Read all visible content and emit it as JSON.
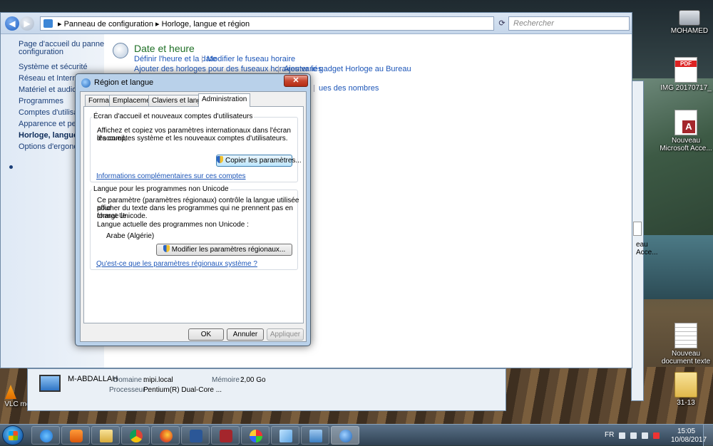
{
  "explorer": {
    "breadcrumb": {
      "part1": "Panneau de configuration",
      "sep": "▸",
      "part2": "Horloge, langue et région"
    },
    "search_placeholder": "Rechercher",
    "sidebar": [
      {
        "label": "Page d'accueil du panneau de"
      },
      {
        "label": "configuration"
      },
      {
        "label": "Système et sécurité"
      },
      {
        "label": "Réseau et Internet"
      },
      {
        "label": "Matériel et audio"
      },
      {
        "label": "Programmes"
      },
      {
        "label": "Comptes d'utilisateurs"
      },
      {
        "label": "Apparence et personn"
      },
      {
        "label": "Horloge, langue et r"
      },
      {
        "label": "Options d'ergonomie"
      }
    ],
    "category": {
      "title": "Date et heure",
      "links": [
        "Définir l'heure et la date",
        "Modifier le fuseau horaire",
        "Ajouter des horloges pour des fuseaux horaires variés",
        "Ajouter le gadget Horloge au Bureau"
      ],
      "partial_link": "ues des nombres"
    }
  },
  "sysinfo": {
    "name": "M-ABDALLAH",
    "domain_label": "Domaine :",
    "domain_value": "mipi.local",
    "memory_label": "Mémoire :",
    "memory_value": "2,00 Go",
    "cpu_label": "Processeur :",
    "cpu_value": "Pentium(R) Dual-Core ..."
  },
  "desktop_icons": [
    {
      "label": "MOHAMED",
      "icon": "computer-icon"
    },
    {
      "label": "IMG 20170717_",
      "icon": "pdf-icon"
    },
    {
      "label": "Nouveau Microsoft Acce...",
      "icon": "access-icon"
    },
    {
      "label": "Nouveau document texte",
      "icon": "text-document-icon"
    },
    {
      "label": "31-13",
      "icon": "folder-icon"
    },
    {
      "label": "VLC med",
      "icon": "vlc-icon"
    }
  ],
  "partial_desktop": {
    "line1": "eau",
    "line2": "Acce..."
  },
  "dialog": {
    "title": "Région et langue",
    "close": "✕",
    "tabs": [
      "Formats",
      "Emplacement",
      "Claviers et langues",
      "Administration"
    ],
    "welcome": {
      "title": "Écran d'accueil et nouveaux comptes d'utilisateurs",
      "line1": "Affichez et copiez vos paramètres internationaux dans l'écran d'accueil,",
      "line2": "les comptes système et les nouveaux comptes d'utilisateurs.",
      "copy_button": "Copier les paramètres...",
      "more_link": "Informations complémentaires sur ces comptes"
    },
    "unicode": {
      "title": "Langue pour les programmes non Unicode",
      "line1": "Ce paramètre (paramètres régionaux) contrôle la langue utilisée pour",
      "line2": "afficher du texte dans les programmes qui ne prennent pas en charge le",
      "line3": "format Unicode.",
      "current_label": "Langue actuelle des programmes non Unicode :",
      "current_value": "Arabe (Algérie)",
      "change_button": "Modifier les paramètres régionaux...",
      "what_link": "Qu'est-ce que les paramètres régionaux système ?"
    },
    "ok": "OK",
    "cancel": "Annuler",
    "apply": "Appliquer"
  },
  "taskbar": {
    "lang": "FR",
    "time": "15:05",
    "date": "10/08/2017",
    "apps": [
      "internet-explorer",
      "media-player",
      "file-explorer",
      "chrome",
      "firefox",
      "word",
      "access",
      "paint",
      "notes",
      "control-panel",
      "region-language"
    ]
  }
}
